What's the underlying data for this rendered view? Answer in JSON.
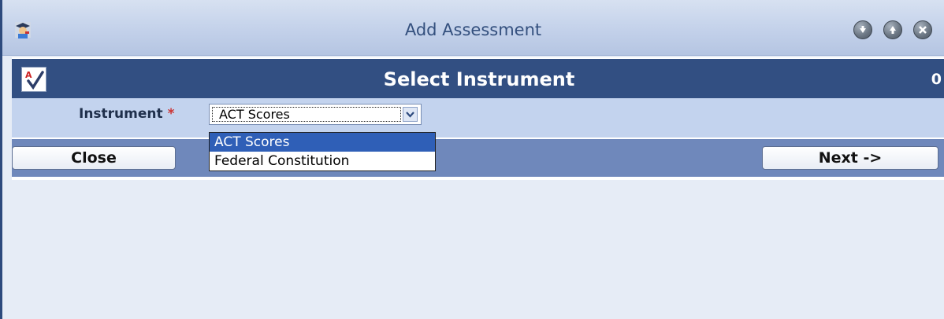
{
  "window": {
    "title": "Add Assessment",
    "buttons": [
      "collapse",
      "expand",
      "close"
    ]
  },
  "panel": {
    "title": "Select Instrument",
    "count": "0"
  },
  "form": {
    "label": "Instrument",
    "required_marker": "*",
    "selected_value": "ACT Scores",
    "options": [
      "ACT Scores",
      "Federal Constitution"
    ]
  },
  "actions": {
    "close_label": "Close",
    "next_label": "Next ->"
  },
  "colors": {
    "header_bg": "#324f82",
    "form_row_bg": "#c3d3ee",
    "button_row_bg": "#6f88bb",
    "selected_option_bg": "#2f5fb7"
  }
}
